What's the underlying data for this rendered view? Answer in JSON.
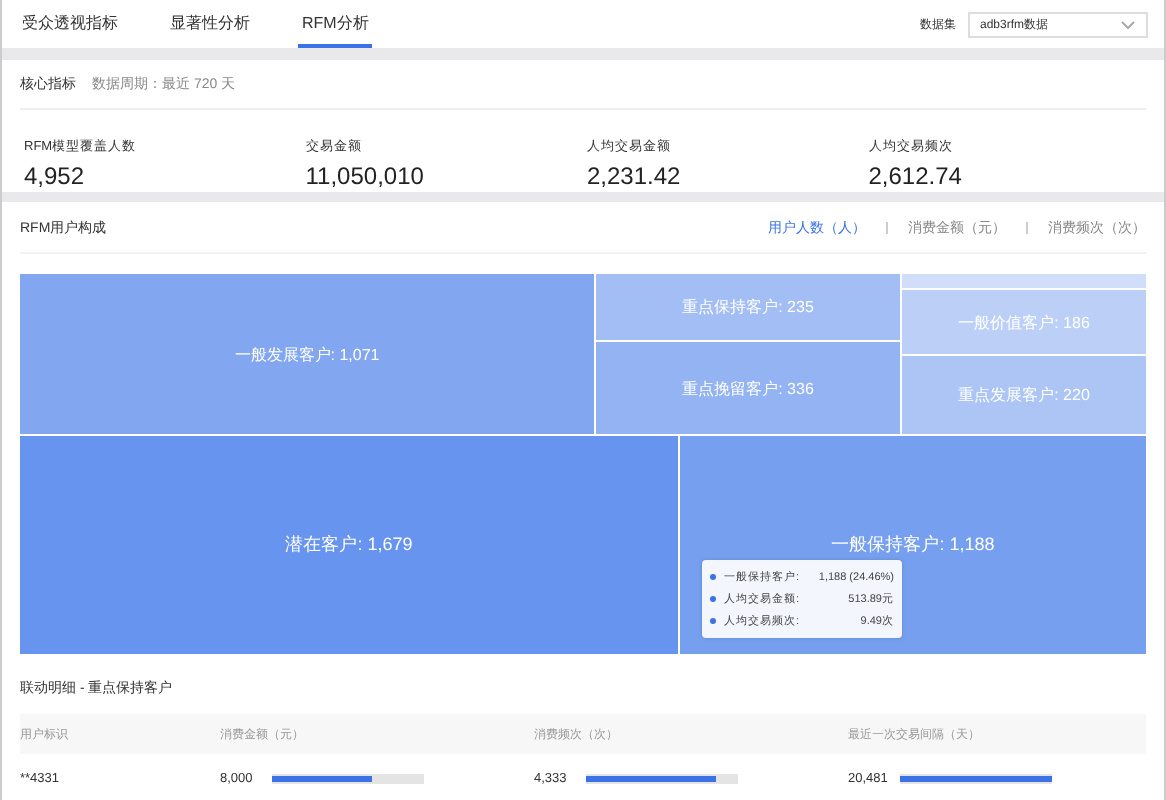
{
  "tabs": [
    {
      "label": "受众透视指标",
      "selected": false
    },
    {
      "label": "显著性分析",
      "selected": false
    },
    {
      "label": "RFM分析",
      "selected": true
    }
  ],
  "dataset": {
    "label": "数据集",
    "value": "adb3rfm数据"
  },
  "core": {
    "title": "核心指标",
    "period": "数据周期：最近 720 天",
    "metrics": [
      {
        "label": "RFM模型覆盖人数",
        "value": "4,952"
      },
      {
        "label": "交易金额",
        "value": "11,050,010"
      },
      {
        "label": "人均交易金额",
        "value": "2,231.42"
      },
      {
        "label": "人均交易频次",
        "value": "2,612.74"
      }
    ]
  },
  "composition": {
    "title": "RFM用户构成",
    "switches": [
      {
        "label": "用户人数（人）",
        "selected": true
      },
      {
        "label": "消费金额（元）",
        "selected": false
      },
      {
        "label": "消费频次（次）",
        "selected": false
      }
    ],
    "cells": [
      {
        "label": "一般发展客户: 1,071",
        "color": "#82a7f0"
      },
      {
        "label": "重点保持客户: 235",
        "color": "#a3bef4"
      },
      {
        "label": "重点挽留客户: 336",
        "color": "#93b3f2"
      },
      {
        "label": "一般价值客户: 186",
        "color": "#bcd0f7"
      },
      {
        "label": "重点发展客户: 220",
        "color": "#adc5f5"
      },
      {
        "label": "潜在客户: 1,679",
        "color": "#6794ee"
      },
      {
        "label": "一般保持客户: 1,188",
        "color": "#76a0ef"
      }
    ],
    "tooltip": [
      {
        "label": "一般保持客户:",
        "value": "1,188 (24.46%)"
      },
      {
        "label": "人均交易金额:",
        "value": "513.89元"
      },
      {
        "label": "人均交易频次:",
        "value": "9.49次"
      }
    ]
  },
  "detail": {
    "title": "联动明细 - 重点保持客户",
    "columns": [
      "用户标识",
      "消费金额（元）",
      "消费频次（次）",
      "最近一次交易间隔（天）"
    ],
    "rows": [
      {
        "cells": [
          {
            "value": "**4331"
          },
          {
            "value": "8,000",
            "level": 0.66
          },
          {
            "value": "4,333",
            "level": 0.85
          },
          {
            "value": "20,481",
            "level": 1
          }
        ]
      }
    ]
  }
}
